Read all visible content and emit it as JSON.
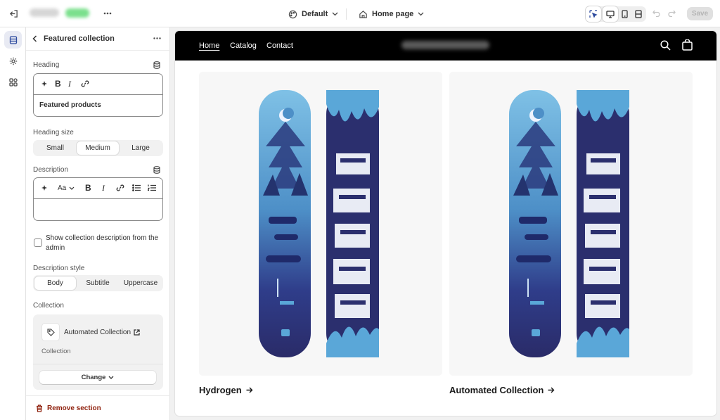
{
  "topbar": {
    "theme_label": "Default",
    "page_label": "Home page",
    "save_label": "Save"
  },
  "panel": {
    "title": "Featured collection",
    "heading_label": "Heading",
    "heading_value": "Featured products",
    "heading_size_label": "Heading size",
    "heading_size_options": [
      "Small",
      "Medium",
      "Large"
    ],
    "heading_size_selected": "Medium",
    "description_label": "Description",
    "description_value": "",
    "font_size_icon_text": "Aa",
    "show_description_label": "Show collection description from the admin",
    "show_description_checked": false,
    "description_style_label": "Description style",
    "description_style_options": [
      "Body",
      "Subtitle",
      "Uppercase"
    ],
    "description_style_selected": "Body",
    "collection_label": "Collection",
    "collection_name": "Automated Collection",
    "collection_sub": "Collection",
    "change_label": "Change",
    "remove_label": "Remove section"
  },
  "preview": {
    "nav_links": [
      "Home",
      "Catalog",
      "Contact"
    ],
    "active_link": "Home",
    "products": [
      {
        "title": "Hydrogen"
      },
      {
        "title": "Automated Collection"
      }
    ]
  },
  "colors": {
    "accent": "#303030",
    "danger": "#8e1f0b",
    "nav_bg": "#000000",
    "board_navy": "#2b2f6e",
    "board_light": "#5aa7d8"
  }
}
